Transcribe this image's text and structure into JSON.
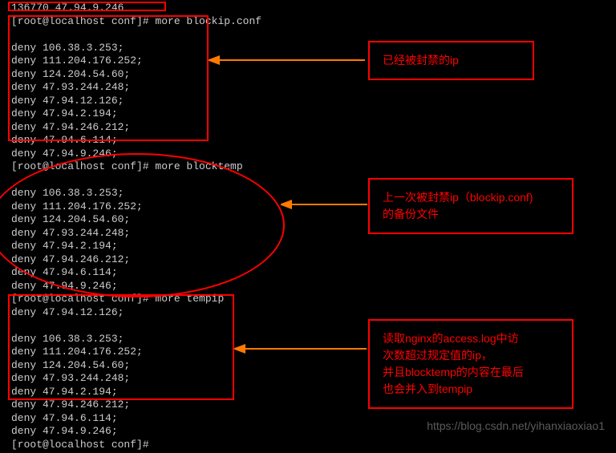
{
  "terminal": {
    "lines": [
      "136770 47.94.9.246",
      "[root@localhost conf]# more blockip.conf",
      "",
      "deny 106.38.3.253;",
      "deny 111.204.176.252;",
      "deny 124.204.54.60;",
      "deny 47.93.244.248;",
      "deny 47.94.12.126;",
      "deny 47.94.2.194;",
      "deny 47.94.246.212;",
      "deny 47.94.6.114;",
      "deny 47.94.9.246;",
      "[root@localhost conf]# more blocktemp",
      "",
      "deny 106.38.3.253;",
      "deny 111.204.176.252;",
      "deny 124.204.54.60;",
      "deny 47.93.244.248;",
      "deny 47.94.2.194;",
      "deny 47.94.246.212;",
      "deny 47.94.6.114;",
      "deny 47.94.9.246;",
      "[root@localhost conf]# more tempip",
      "deny 47.94.12.126;",
      "",
      "deny 106.38.3.253;",
      "deny 111.204.176.252;",
      "deny 124.204.54.60;",
      "deny 47.93.244.248;",
      "deny 47.94.2.194;",
      "deny 47.94.246.212;",
      "deny 47.94.6.114;",
      "deny 47.94.9.246;",
      "[root@localhost conf]#"
    ]
  },
  "annotations": {
    "box1": "已经被封禁的ip",
    "box2_line1": "上一次被封禁ip（blockip.conf)",
    "box2_line2": "的备份文件",
    "box3_line1": "读取nginx的access.log中访",
    "box3_line2": "次数超过规定值的ip，",
    "box3_line3": "并且blocktemp的内容在最后",
    "box3_line4": "也会并入到tempip"
  },
  "watermark": "https://blog.csdn.net/yihanxiaoxiao1"
}
